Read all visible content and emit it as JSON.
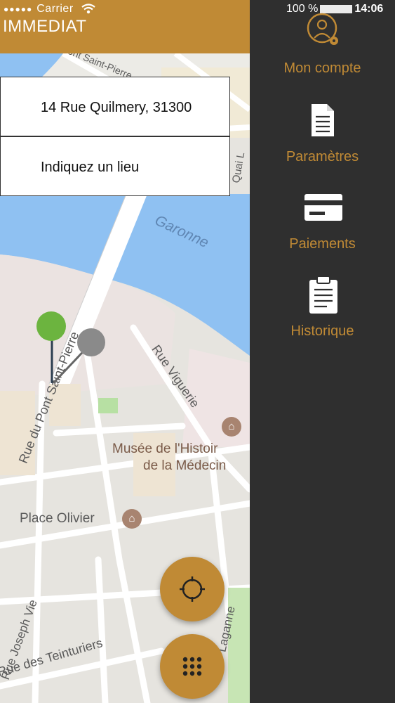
{
  "status": {
    "carrier": "Carrier",
    "signal_dots": "●●●●●",
    "battery_pct": "100 %",
    "time": "14:06"
  },
  "header": {
    "title": "IMMEDIAT"
  },
  "search": {
    "from_value": "14 Rue Quilmery, 31300",
    "to_placeholder": "Indiquez un lieu"
  },
  "map": {
    "street_labels": [
      "Garonne",
      "Rue du Pont Saint-Pierre",
      "Rue Viguerie",
      "Rue des Teinturiers",
      "Rue Joseph Vie",
      "Laganne",
      "Pont Saint-Pierre",
      "Quai L"
    ],
    "poi": [
      {
        "name_line1": "Musée de l'Histoir",
        "name_line2": "de la Médecin"
      },
      {
        "name_line1": "Place Olivier"
      }
    ]
  },
  "menu": {
    "items": [
      {
        "label": "Mon compte",
        "icon": "account-gear-icon"
      },
      {
        "label": "Paramètres",
        "icon": "document-icon"
      },
      {
        "label": "Paiements",
        "icon": "credit-card-icon"
      },
      {
        "label": "Historique",
        "icon": "clipboard-icon"
      }
    ]
  },
  "colors": {
    "accent": "#c08a35",
    "menu_bg": "#2f2f2f",
    "water": "#8fc1f2",
    "pin": "#6cb43f"
  }
}
